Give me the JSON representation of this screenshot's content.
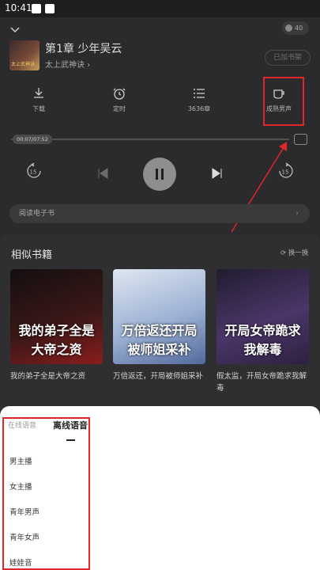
{
  "status_bar": {
    "time": "10:41"
  },
  "header": {
    "cover_text": "太上武神诀",
    "chapter_title": "第1章 少年吴云",
    "book_name": "太上武神诀 ›",
    "coin_value": "40",
    "add_shelf_label": "已加书架"
  },
  "functions": [
    {
      "label": "下载",
      "icon": "download-icon"
    },
    {
      "label": "定时",
      "icon": "timer-icon"
    },
    {
      "label": "3636章",
      "icon": "list-icon"
    },
    {
      "label": "成熟男声",
      "icon": "voice-cup-icon"
    }
  ],
  "player": {
    "time_label": "00:07/07:52",
    "rewind_label": "15",
    "forward_label": "15",
    "read_ebook_label": "阅读电子书"
  },
  "similar": {
    "title": "相似书籍",
    "refresh_label": "换一换",
    "books": [
      {
        "cover_text": "我的弟子全是大帝之资",
        "title": "我的弟子全是大帝之资",
        "colors": [
          "#1a1414",
          "#6b1b1b"
        ]
      },
      {
        "cover_text": "万倍返还开局被师姐采补",
        "title": "万倍返还，开局被师姐采补",
        "colors": [
          "#c9d6e6",
          "#6f87b8"
        ]
      },
      {
        "cover_text": "开局女帝跪求我解毒",
        "title": "假太监，开局女帝跪求我解毒",
        "colors": [
          "#2a2338",
          "#5a3f7a"
        ]
      }
    ]
  },
  "voice_panel": {
    "tab_online": "在线语音",
    "tab_offline": "离线语音",
    "voices": [
      "男主播",
      "女主播",
      "青年男声",
      "青年女声",
      "娃娃音"
    ]
  },
  "highlight_color": "#e0262b"
}
